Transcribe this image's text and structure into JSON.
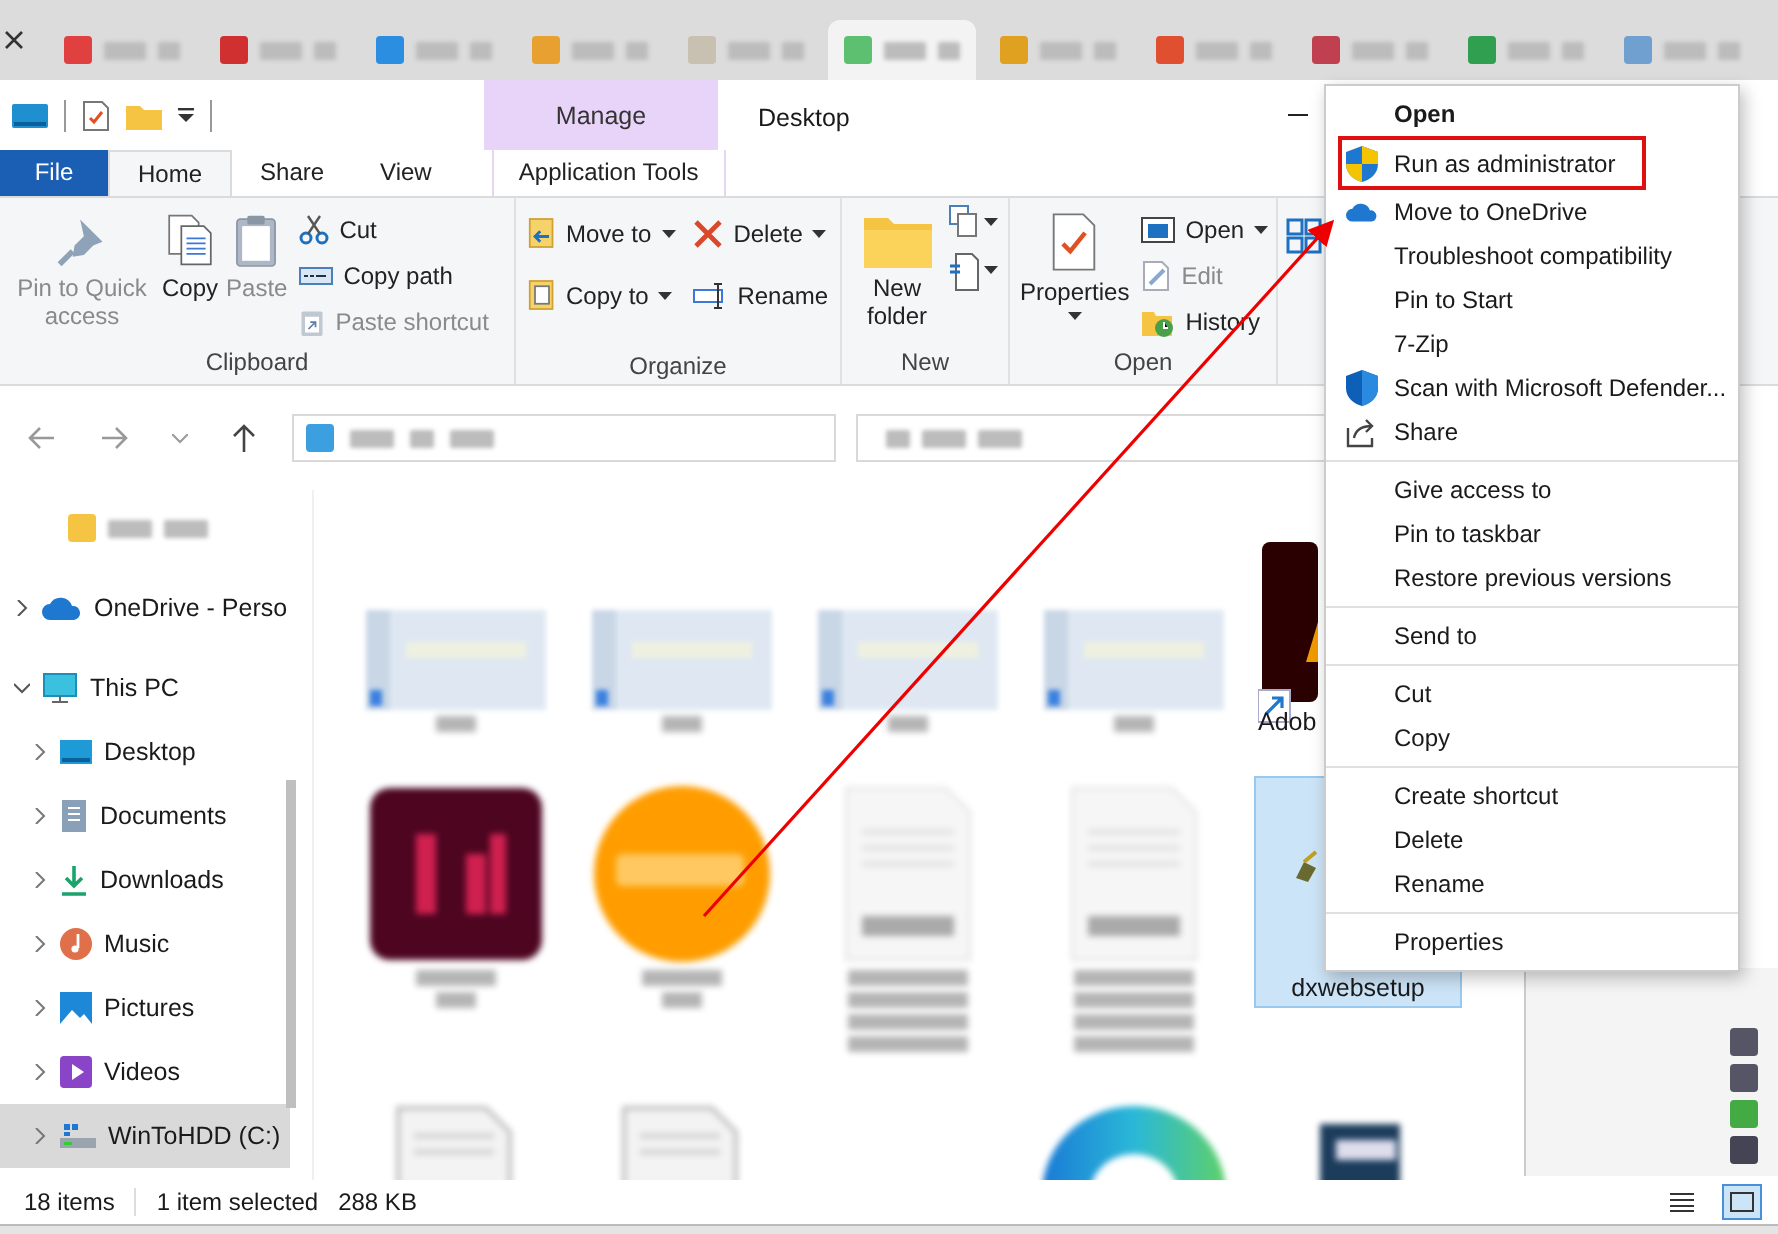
{
  "browser_tabs": [
    {
      "color": "#e04040",
      "selected": false
    },
    {
      "color": "#d03030",
      "selected": false
    },
    {
      "color": "#2b8ee0",
      "selected": false
    },
    {
      "color": "#e8a030",
      "selected": false
    },
    {
      "color": "#c8c0b0",
      "selected": false
    },
    {
      "color": "#5cc070",
      "selected": true
    },
    {
      "color": "#e0a020",
      "selected": false
    },
    {
      "color": "#e05030",
      "selected": false
    },
    {
      "color": "#c04050",
      "selected": false
    },
    {
      "color": "#30a050",
      "selected": false
    },
    {
      "color": "#70a0d0",
      "selected": false
    }
  ],
  "window": {
    "title": "Desktop",
    "contextual_group": "Manage"
  },
  "tabs": [
    {
      "label": "File",
      "kind": "file",
      "selected": false
    },
    {
      "label": "Home",
      "kind": "plain",
      "selected": true
    },
    {
      "label": "Share",
      "kind": "plain",
      "selected": false
    },
    {
      "label": "View",
      "kind": "plain",
      "selected": false
    },
    {
      "label": "Application Tools",
      "kind": "contextual",
      "selected": false
    }
  ],
  "ribbon": {
    "clipboard": {
      "label": "Clipboard",
      "large": [
        {
          "label": "Pin to Quick access",
          "disabled": true
        },
        {
          "label": "Copy",
          "disabled": false
        },
        {
          "label": "Paste",
          "disabled": true
        }
      ],
      "small": [
        {
          "label": "Cut",
          "disabled": false
        },
        {
          "label": "Copy path",
          "disabled": false
        },
        {
          "label": "Paste shortcut",
          "disabled": true
        }
      ]
    },
    "organize": {
      "label": "Organize",
      "items": [
        {
          "label": "Move to"
        },
        {
          "label": "Copy to"
        },
        {
          "label": "Delete"
        },
        {
          "label": "Rename"
        }
      ]
    },
    "new": {
      "label": "New",
      "large": {
        "label": "New folder"
      }
    },
    "open": {
      "label": "Open",
      "large": {
        "label": "Properties"
      },
      "small": [
        {
          "label": "Open",
          "disabled": false
        },
        {
          "label": "Edit",
          "disabled": true
        },
        {
          "label": "History",
          "disabled": false
        }
      ]
    }
  },
  "sidebar": {
    "items": [
      {
        "label": "OneDrive - Perso",
        "kind": "cloud",
        "expanded": false,
        "selected": false
      },
      {
        "label": "This PC",
        "kind": "pc",
        "expanded": true,
        "selected": false,
        "children": [
          {
            "label": "Desktop",
            "kind": "desktop",
            "expanded": false,
            "selected": false
          },
          {
            "label": "Documents",
            "kind": "documents",
            "expanded": false,
            "selected": false
          },
          {
            "label": "Downloads",
            "kind": "downloads",
            "expanded": false,
            "selected": false
          },
          {
            "label": "Music",
            "kind": "music",
            "expanded": false,
            "selected": false
          },
          {
            "label": "Pictures",
            "kind": "pictures",
            "expanded": false,
            "selected": false
          },
          {
            "label": "Videos",
            "kind": "videos",
            "expanded": false,
            "selected": false
          },
          {
            "label": "WinToHDD (C:)",
            "kind": "drive",
            "expanded": false,
            "selected": true
          }
        ]
      }
    ]
  },
  "files": [
    {
      "kind": "screenshot",
      "selected": false
    },
    {
      "kind": "screenshot",
      "selected": false
    },
    {
      "kind": "screenshot",
      "selected": false
    },
    {
      "kind": "screenshot",
      "selected": false
    },
    {
      "kind": "adobe",
      "label": "Adob",
      "selected": false
    },
    {
      "kind": "app-dark",
      "selected": false
    },
    {
      "kind": "app-orange",
      "selected": false
    },
    {
      "kind": "document",
      "selected": false
    },
    {
      "kind": "document",
      "selected": false
    },
    {
      "kind": "installer",
      "label": "dxwebsetup",
      "selected": true
    },
    {
      "kind": "page",
      "selected": false
    },
    {
      "kind": "page",
      "selected": false
    },
    {
      "kind": "empty",
      "selected": false
    },
    {
      "kind": "arc",
      "selected": false
    },
    {
      "kind": "dark-thumb",
      "selected": false
    }
  ],
  "status_bar": {
    "count": "18 items",
    "selection": "1 item selected",
    "size": "288 KB",
    "views": [
      {
        "kind": "details",
        "selected": false
      },
      {
        "kind": "icons",
        "selected": true
      }
    ]
  },
  "context_menu": {
    "sections": [
      [
        {
          "label": "Open",
          "kind": "plain",
          "default": true,
          "highlighted": false
        },
        {
          "label": "Run as administrator",
          "kind": "uac",
          "default": false,
          "highlighted": true
        },
        {
          "label": "Move to OneDrive",
          "kind": "cloud",
          "default": false,
          "highlighted": false
        },
        {
          "label": "Troubleshoot compatibility",
          "kind": "plain",
          "default": false,
          "highlighted": false
        },
        {
          "label": "Pin to Start",
          "kind": "plain",
          "default": false,
          "highlighted": false
        },
        {
          "label": "7-Zip",
          "kind": "plain",
          "default": false,
          "highlighted": false
        },
        {
          "label": "Scan with Microsoft Defender...",
          "kind": "defender",
          "default": false,
          "highlighted": false
        },
        {
          "label": "Share",
          "kind": "share",
          "default": false,
          "highlighted": false
        }
      ],
      [
        {
          "label": "Give access to",
          "kind": "plain",
          "default": false,
          "highlighted": false
        },
        {
          "label": "Pin to taskbar",
          "kind": "plain",
          "default": false,
          "highlighted": false
        },
        {
          "label": "Restore previous versions",
          "kind": "plain",
          "default": false,
          "highlighted": false
        }
      ],
      [
        {
          "label": "Send to",
          "kind": "plain",
          "default": false,
          "highlighted": false
        }
      ],
      [
        {
          "label": "Cut",
          "kind": "plain",
          "default": false,
          "highlighted": false
        },
        {
          "label": "Copy",
          "kind": "plain",
          "default": false,
          "highlighted": false
        }
      ],
      [
        {
          "label": "Create shortcut",
          "kind": "plain",
          "default": false,
          "highlighted": false
        },
        {
          "label": "Delete",
          "kind": "plain",
          "default": false,
          "highlighted": false
        },
        {
          "label": "Rename",
          "kind": "plain",
          "default": false,
          "highlighted": false
        }
      ],
      [
        {
          "label": "Properties",
          "kind": "plain",
          "default": false,
          "highlighted": false
        }
      ]
    ]
  }
}
